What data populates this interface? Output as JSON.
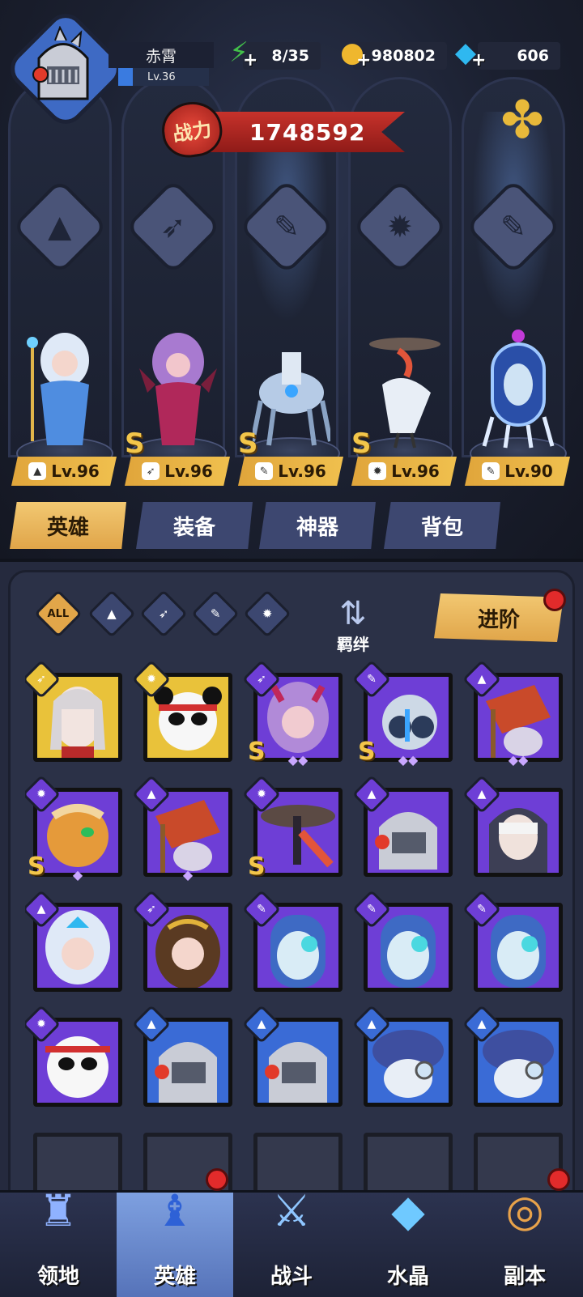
{
  "player": {
    "name": "赤霄",
    "level": "Lv.36"
  },
  "resources": {
    "energy": "8/35",
    "gold": "980802",
    "diamonds": "606"
  },
  "power": {
    "label": "战力",
    "value": "1748592"
  },
  "lineup": [
    {
      "level": "Lv.96",
      "class_icon": "mage-icon",
      "rank": ""
    },
    {
      "level": "Lv.96",
      "class_icon": "wing-icon",
      "rank": "S"
    },
    {
      "level": "Lv.96",
      "class_icon": "wrench-icon",
      "rank": "S"
    },
    {
      "level": "Lv.96",
      "class_icon": "claw-icon",
      "rank": "S"
    },
    {
      "level": "Lv.90",
      "class_icon": "wrench-icon",
      "rank": ""
    }
  ],
  "tabs": [
    {
      "label": "英雄",
      "active": true
    },
    {
      "label": "装备",
      "active": false
    },
    {
      "label": "神器",
      "active": false
    },
    {
      "label": "背包",
      "active": false
    }
  ],
  "filters": {
    "all_label": "ALL",
    "bond_label": "羁绊",
    "advance_label": "进阶"
  },
  "hero_cards": [
    {
      "frame": "gold",
      "rank": "",
      "stars": ""
    },
    {
      "frame": "gold",
      "rank": "",
      "stars": ""
    },
    {
      "frame": "purple",
      "rank": "S",
      "stars": "◆◆"
    },
    {
      "frame": "purple",
      "rank": "S",
      "stars": "◆◆"
    },
    {
      "frame": "purple",
      "rank": "",
      "stars": "◆◆"
    },
    {
      "frame": "purple",
      "rank": "S",
      "stars": "◆"
    },
    {
      "frame": "purple",
      "rank": "",
      "stars": "◆"
    },
    {
      "frame": "purple",
      "rank": "S",
      "stars": ""
    },
    {
      "frame": "purple",
      "rank": "",
      "stars": ""
    },
    {
      "frame": "purple",
      "rank": "",
      "stars": ""
    },
    {
      "frame": "purple",
      "rank": "",
      "stars": ""
    },
    {
      "frame": "purple",
      "rank": "",
      "stars": ""
    },
    {
      "frame": "purple",
      "rank": "",
      "stars": ""
    },
    {
      "frame": "purple",
      "rank": "",
      "stars": ""
    },
    {
      "frame": "purple",
      "rank": "",
      "stars": ""
    },
    {
      "frame": "purple",
      "rank": "",
      "stars": ""
    },
    {
      "frame": "blue",
      "rank": "",
      "stars": ""
    },
    {
      "frame": "blue",
      "rank": "",
      "stars": ""
    },
    {
      "frame": "blue",
      "rank": "",
      "stars": ""
    },
    {
      "frame": "blue",
      "rank": "",
      "stars": ""
    }
  ],
  "bottom_nav": [
    {
      "label": "领地",
      "icon": "castle-icon",
      "active": false
    },
    {
      "label": "英雄",
      "icon": "hero-hat-icon",
      "active": true
    },
    {
      "label": "战斗",
      "icon": "sword-icon",
      "active": false
    },
    {
      "label": "水晶",
      "icon": "crystal-icon",
      "active": false
    },
    {
      "label": "副本",
      "icon": "portal-icon",
      "active": false
    }
  ],
  "colors": {
    "accent_gold": "#e2a649",
    "frame_purple": "#6e3ed6",
    "frame_blue": "#3a6bd6",
    "frame_gold": "#e9c23a",
    "power_red": "#c7322b"
  }
}
